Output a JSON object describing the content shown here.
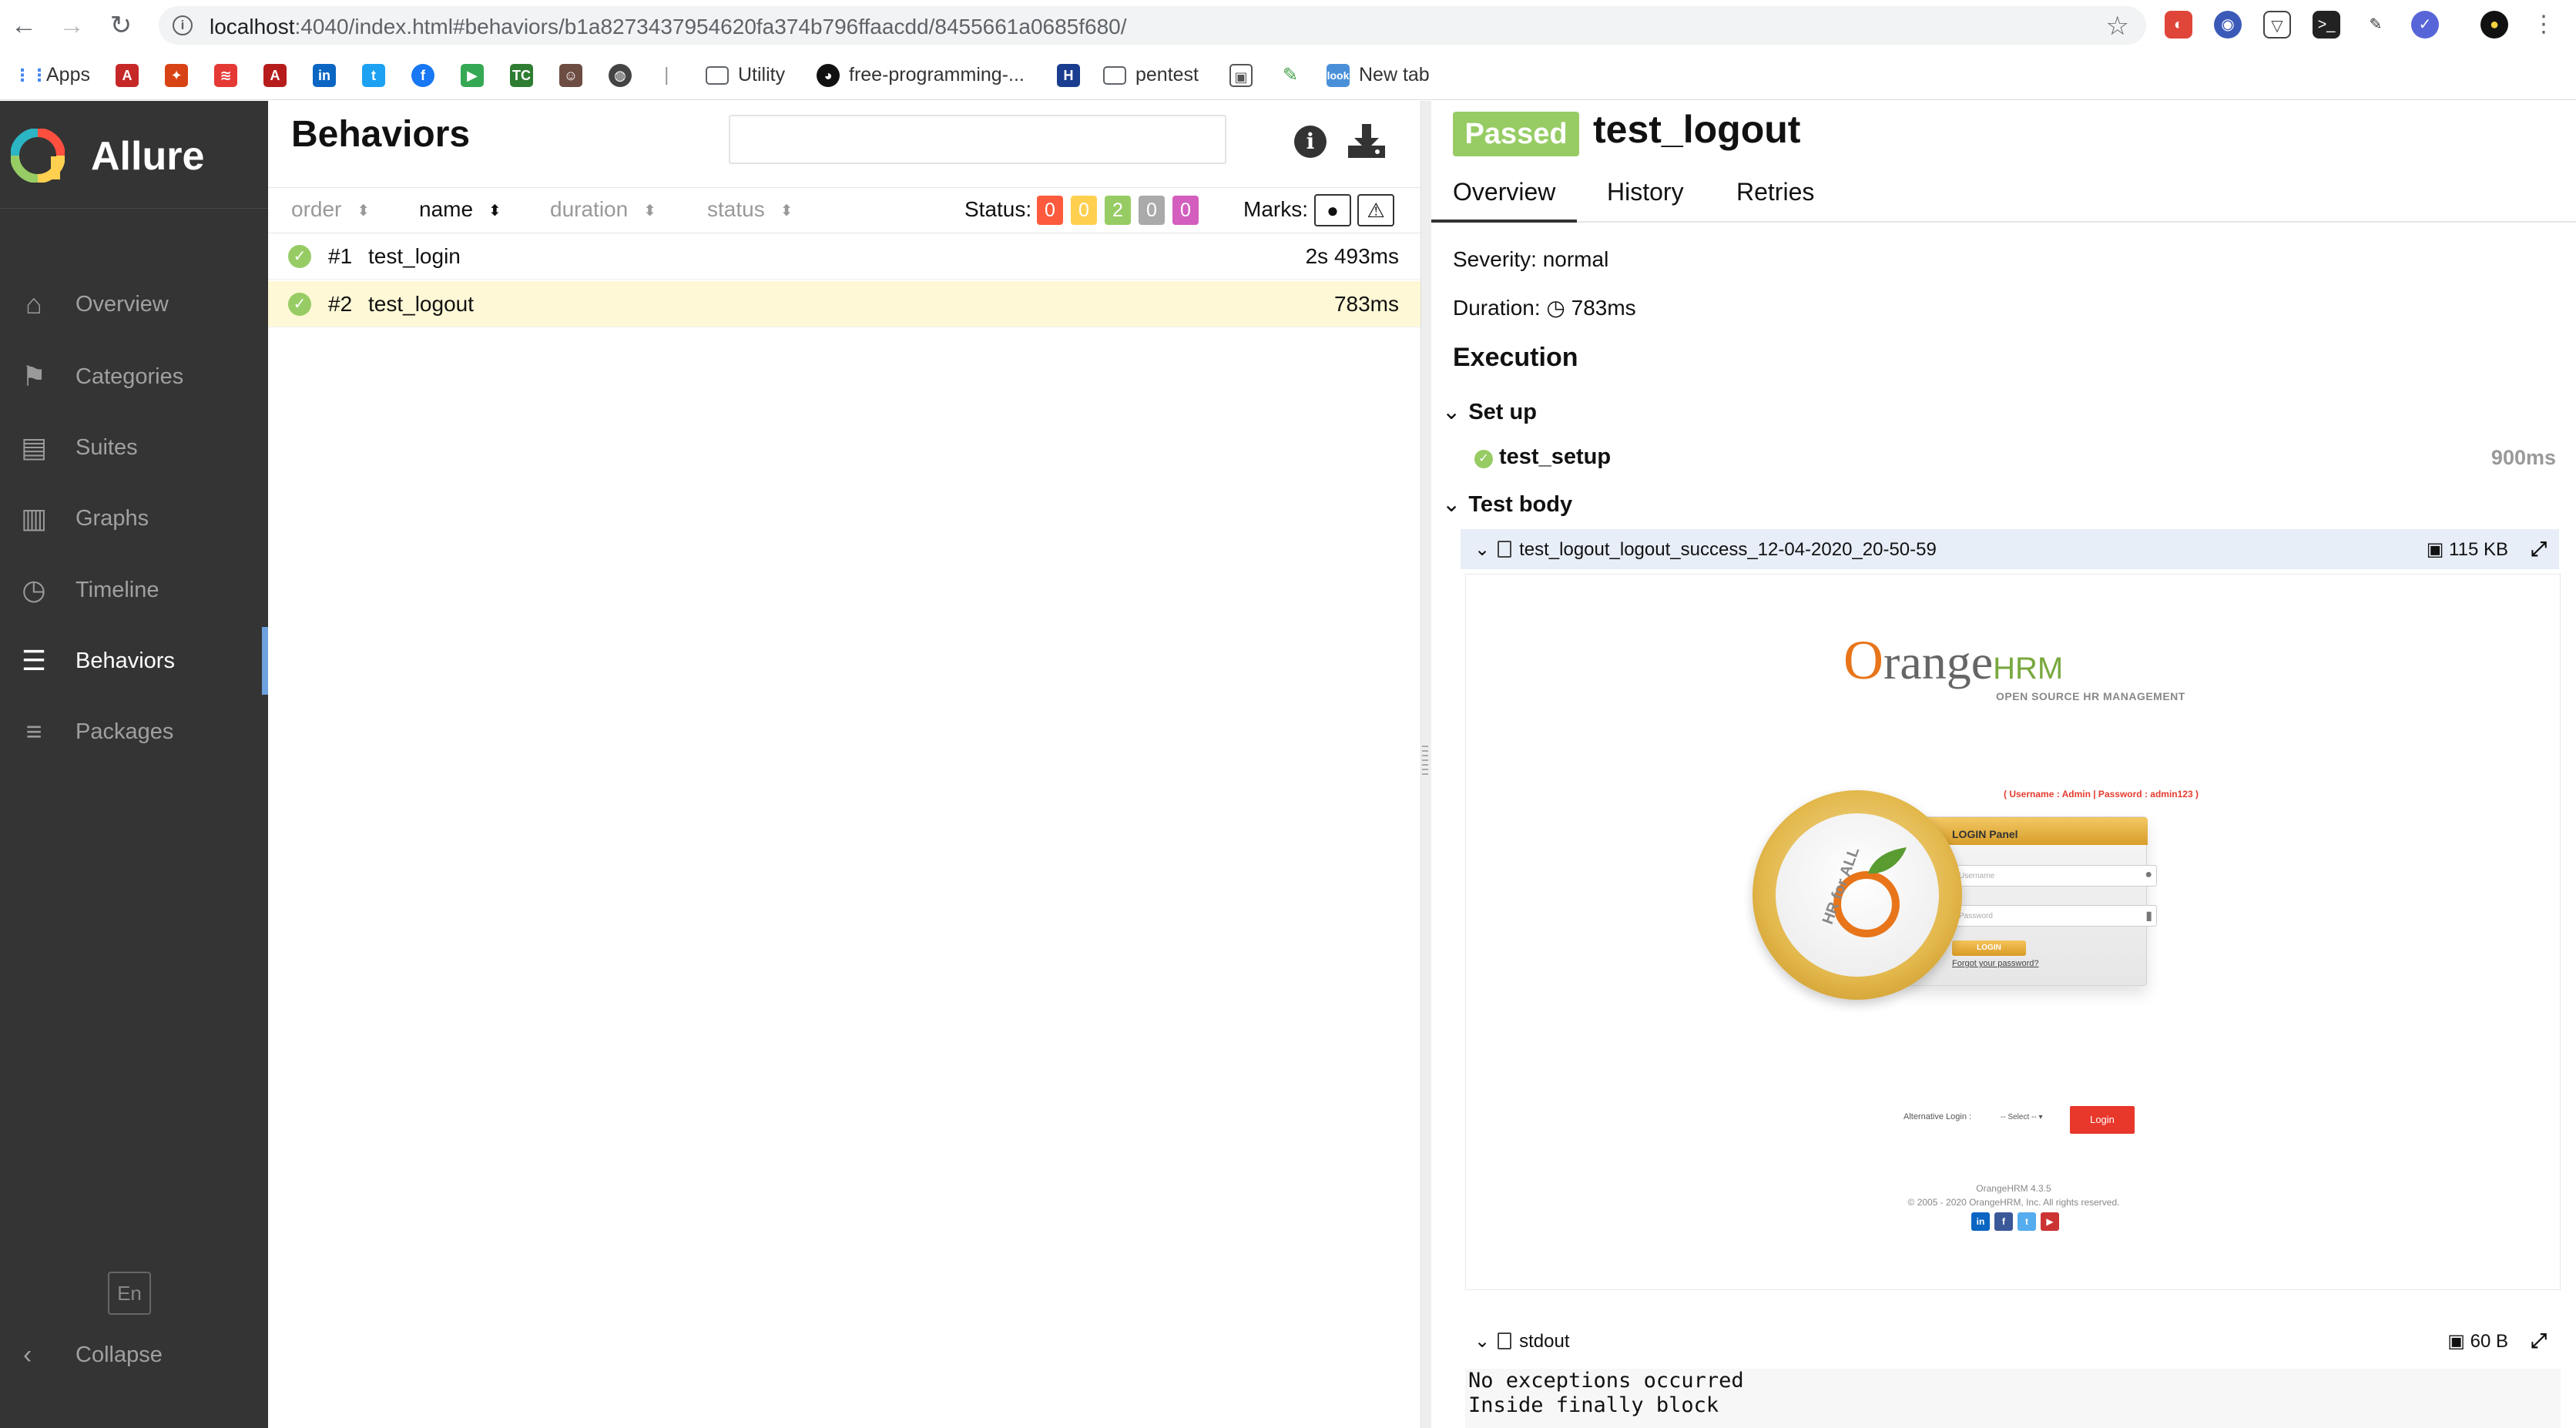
{
  "browser": {
    "url_host": "localhost",
    "url_path": ":4040/index.html#behaviors/b1a8273437954620fa374b796ffaacdd/8455661a0685f680/",
    "bookmarks": {
      "apps": "Apps",
      "utility": "Utility",
      "free_programming": "free-programming-...",
      "pentest": "pentest",
      "new_tab": "New tab"
    }
  },
  "sidebar": {
    "brand": "Allure",
    "items": [
      {
        "label": "Overview",
        "icon": "home-icon"
      },
      {
        "label": "Categories",
        "icon": "flag-icon"
      },
      {
        "label": "Suites",
        "icon": "briefcase-icon"
      },
      {
        "label": "Graphs",
        "icon": "bar-chart-icon"
      },
      {
        "label": "Timeline",
        "icon": "clock-icon"
      },
      {
        "label": "Behaviors",
        "icon": "list-icon"
      },
      {
        "label": "Packages",
        "icon": "align-left-icon"
      }
    ],
    "active": "Behaviors",
    "language": "En",
    "collapse": "Collapse"
  },
  "behaviors": {
    "title": "Behaviors",
    "search_value": "",
    "sort_columns": [
      "order",
      "name",
      "duration",
      "status"
    ],
    "status_label": "Status:",
    "status_counts": [
      {
        "value": "0",
        "color": "#fd5a3e"
      },
      {
        "value": "0",
        "color": "#ffd050"
      },
      {
        "value": "2",
        "color": "#97cc64"
      },
      {
        "value": "0",
        "color": "#aaaaaa"
      },
      {
        "value": "0",
        "color": "#d35ebe"
      }
    ],
    "marks_label": "Marks:",
    "rows": [
      {
        "num": "#1",
        "name": "test_login",
        "duration": "2s 493ms",
        "selected": false
      },
      {
        "num": "#2",
        "name": "test_logout",
        "duration": "783ms",
        "selected": true
      }
    ]
  },
  "detail": {
    "status": "Passed",
    "title": "test_logout",
    "tabs": [
      "Overview",
      "History",
      "Retries"
    ],
    "severity": "Severity: normal",
    "duration_label": "Duration:",
    "duration_value": "783ms",
    "execution_heading": "Execution",
    "setup_heading": "Set up",
    "setup_step": "test_setup",
    "setup_duration": "900ms",
    "body_heading": "Test body",
    "attachment1": {
      "name": "test_logout_logout_success_12-04-2020_20-50-59",
      "size": "115 KB"
    },
    "attachment2": {
      "name": "stdout",
      "size": "60 B"
    },
    "stdout_lines": [
      "No exceptions occurred",
      "Inside finally block"
    ]
  },
  "screenshot": {
    "logo_o": "O",
    "logo_range": "range",
    "logo_hrm": "HRM",
    "tagline": "OPEN SOURCE HR MANAGEMENT",
    "credentials_hint": "( Username : Admin | Password : admin123 )",
    "panel_title": "LOGIN Panel",
    "username_placeholder": "Username",
    "password_placeholder": "Password",
    "login_button": "LOGIN",
    "forgot": "Forgot your password?",
    "alt_login_label": "Alternative Login :",
    "alt_select": "-- Select --",
    "alt_button": "Login",
    "version": "OrangeHRM 4.3.5",
    "copyright": "© 2005 - 2020 OrangeHRM, Inc. All rights reserved.",
    "medallion_text": "HR for ALL"
  }
}
